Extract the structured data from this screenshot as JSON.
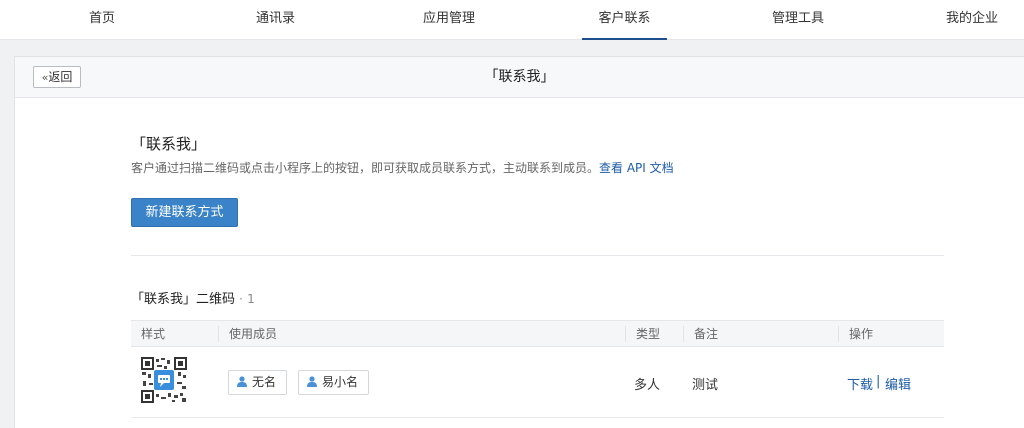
{
  "nav": {
    "items": [
      {
        "label": "首页"
      },
      {
        "label": "通讯录"
      },
      {
        "label": "应用管理"
      },
      {
        "label": "客户联系"
      },
      {
        "label": "管理工具"
      },
      {
        "label": "我的企业"
      }
    ],
    "active": "客户联系"
  },
  "panel": {
    "back_label": "返回",
    "title": "「联系我」"
  },
  "intro": {
    "title": "「联系我」",
    "desc": "客户通过扫描二维码或点击小程序上的按钮，即可获取成员联系方式，主动联系到成员。",
    "api_link": "查看 API 文档",
    "new_button": "新建联系方式"
  },
  "list": {
    "title": "「联系我」二维码",
    "count_sep": "·",
    "count": "1",
    "columns": [
      "样式",
      "使用成员",
      "类型",
      "备注",
      "操作"
    ],
    "rows": [
      {
        "style_icon": "qr-code-icon",
        "members": [
          "无名",
          "易小名"
        ],
        "type": "多人",
        "remark": "测试",
        "actions": [
          "下载",
          "编辑"
        ],
        "action_sep": "|"
      }
    ]
  },
  "colors": {
    "accent": "#3a83c8",
    "link": "#1e5ca8",
    "nav_active_underline": "#1e4f8c",
    "qr_center": "#3a8fdc"
  }
}
